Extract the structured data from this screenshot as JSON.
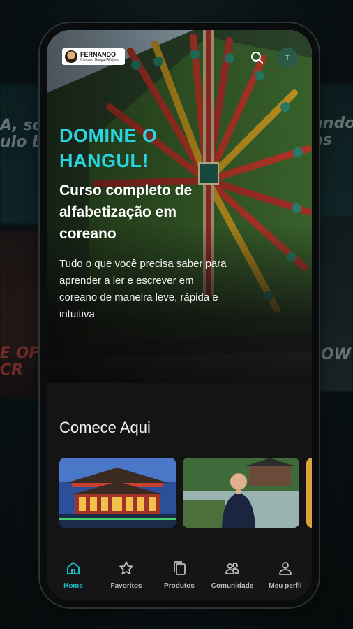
{
  "background": {
    "left_text": "A, sou\nulo ba",
    "right_text": "ando\nas",
    "left_bottom_text": "E OF\nCR",
    "right_bottom_text": "OW"
  },
  "header": {
    "logo_name": "FERNANDO",
    "logo_sub": "Coreano Hangul/Alfabeto",
    "avatar_initial": "T"
  },
  "hero": {
    "kicker": "DOMINE O HANGUL!",
    "title": "Curso completo de alfabetização em coreano",
    "description": "Tudo o que você precisa saber para aprender a ler e escrever em coreano de maneira leve, rápida e intuitiva"
  },
  "section": {
    "title": "Comece Aqui"
  },
  "nav": {
    "items": [
      {
        "label": "Home",
        "icon": "home-icon",
        "active": true
      },
      {
        "label": "Favoritos",
        "icon": "star-icon",
        "active": false
      },
      {
        "label": "Produtos",
        "icon": "copy-icon",
        "active": false
      },
      {
        "label": "Comunidade",
        "icon": "community-icon",
        "active": false
      },
      {
        "label": "Meu perfil",
        "icon": "user-icon",
        "active": false
      }
    ]
  },
  "colors": {
    "accent": "#29d3df",
    "nav_active": "#1fb9c6",
    "avatar_bg": "#2b5948"
  }
}
